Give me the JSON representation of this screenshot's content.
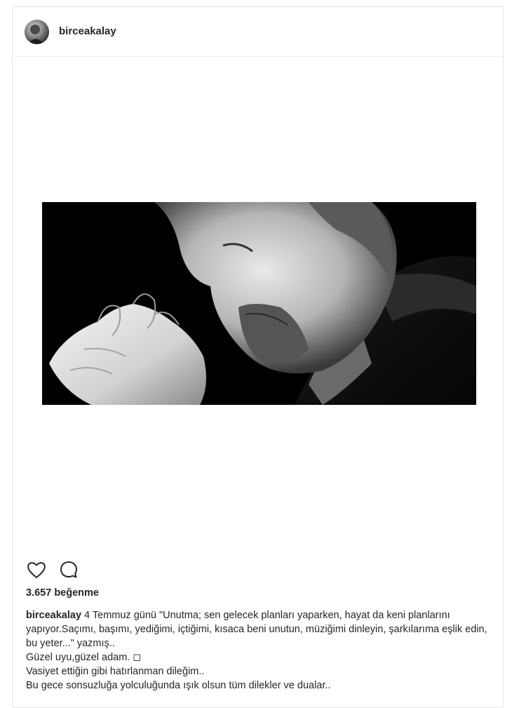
{
  "post": {
    "username": "birceakalay",
    "likes": "3.657 beğenme",
    "caption_user": "birceakalay",
    "caption_text": " 4 Temmuz günü \"Unutma; sen gelecek planları yaparken, hayat da keni planlarını yapıyor.Saçımı, başımı, yediğimi, içtiğimi, kısaca beni unutun, müziğimi dinleyin, şarkılarıma eşlik edin, bu yeter...\" yazmış..",
    "caption_line2": "Güzel uyu,güzel adam. ◻",
    "caption_line3": "Vasiyet ettiğin gibi hatırlanman dileğim..",
    "caption_line4": "Bu gece sonsuzluğa yolculuğunda ışık olsun tüm dilekler ve dualar.."
  },
  "icons": {
    "like": "heart-icon",
    "comment": "comment-icon"
  },
  "colors": {
    "text": "#262626",
    "border": "#e6e6e6",
    "photo_background": "#000000"
  }
}
